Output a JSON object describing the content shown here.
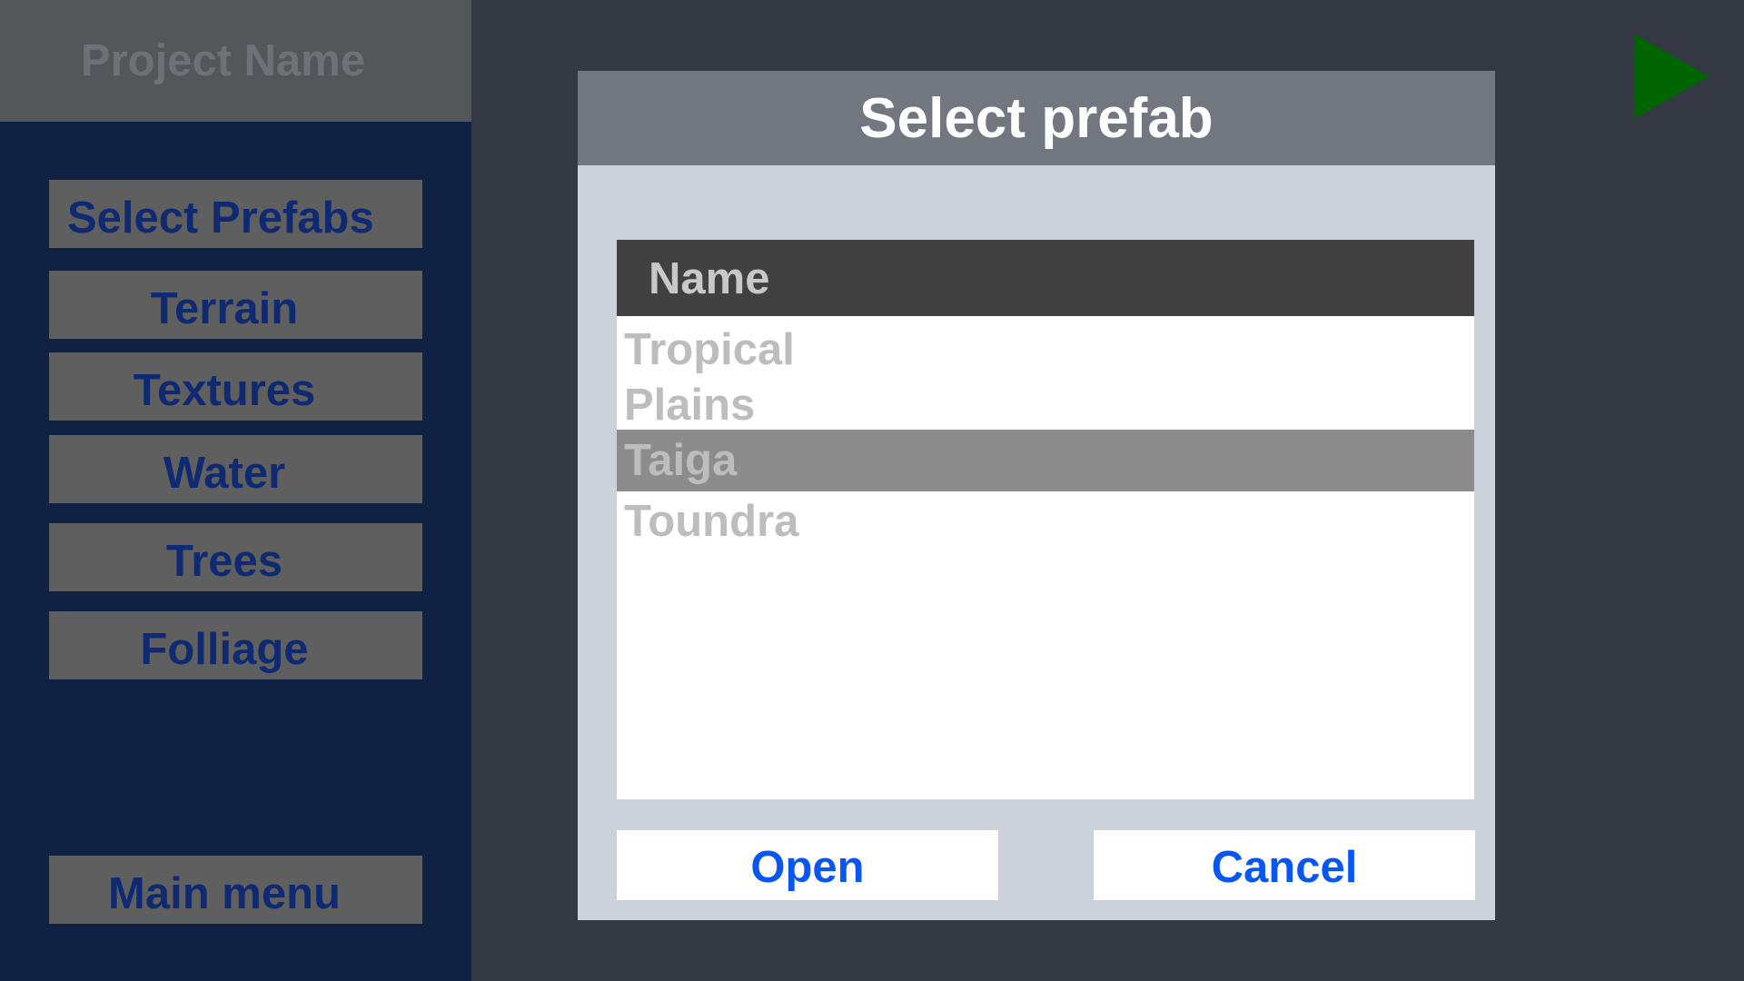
{
  "sidebar": {
    "project_name": "Project Name",
    "items": [
      {
        "label": "Select Prefabs"
      },
      {
        "label": "Terrain"
      },
      {
        "label": "Textures"
      },
      {
        "label": "Water"
      },
      {
        "label": "Trees"
      },
      {
        "label": "Folliage"
      }
    ],
    "main_menu_label": "Main menu"
  },
  "toolbar": {
    "play_icon": "play-icon",
    "play_color": "#006400"
  },
  "dialog": {
    "title": "Select prefab",
    "list": {
      "header": "Name",
      "items": [
        {
          "label": "Tropical"
        },
        {
          "label": "Plains"
        },
        {
          "label": "Taiga"
        },
        {
          "label": "Toundra"
        }
      ],
      "selected": "Taiga"
    },
    "open_label": "Open",
    "cancel_label": "Cancel"
  }
}
